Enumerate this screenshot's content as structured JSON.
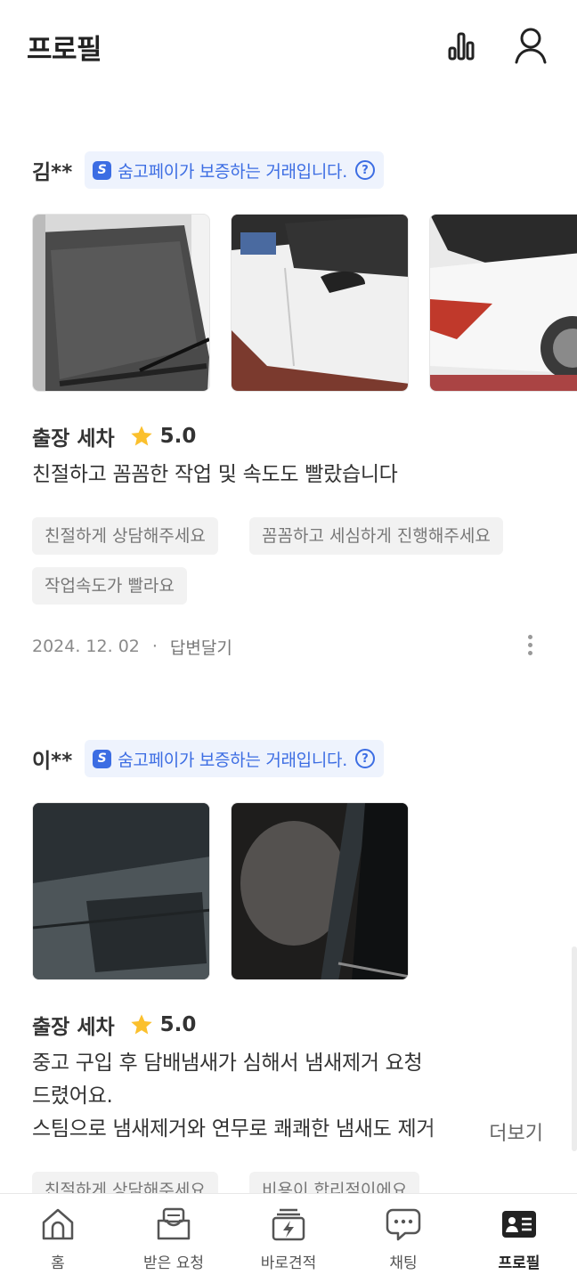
{
  "header": {
    "title": "프로필",
    "stats_icon": "bar-chart-icon",
    "user_icon": "user-icon"
  },
  "reviews": [
    {
      "reviewer": "김**",
      "badge": {
        "text": "숨고페이가 보증하는 거래입니다.",
        "logo": "S",
        "help": "?"
      },
      "photos": [
        "car-windshield-photo",
        "white-car-door-photo",
        "white-car-rear-photo"
      ],
      "service": "출장 세차",
      "rating": "5.0",
      "text_lines": [
        "친절하고 꼼꼼한 작업 및 속도도 빨랐습니다"
      ],
      "tags": [
        "친절하게 상담해주세요",
        "꼼꼼하고 세심하게 진행해주세요",
        "작업속도가 빨라요"
      ],
      "date": "2024. 12. 02",
      "dot": "·",
      "reply": "답변달기"
    },
    {
      "reviewer": "이**",
      "badge": {
        "text": "숨고페이가 보증하는 거래입니다.",
        "logo": "S",
        "help": "?"
      },
      "photos": [
        "dark-windshield-photo",
        "dark-car-interior-photo"
      ],
      "service": "출장 세차",
      "rating": "5.0",
      "text_lines": [
        "중고 구입 후 담배냄새가 심해서 냄새제거 요청",
        "드렸어요.",
        "스팀으로 냄새제거와 연무로 쾌쾌한 냄새도 제거"
      ],
      "more": "더보기",
      "tags": [
        "친절하게 상담해주세요",
        "비용이 합리적이에요"
      ]
    }
  ],
  "nav": [
    {
      "label": "홈",
      "icon": "home-icon",
      "active": false
    },
    {
      "label": "받은 요청",
      "icon": "inbox-icon",
      "active": false
    },
    {
      "label": "바로견적",
      "icon": "lightning-quote-icon",
      "active": false
    },
    {
      "label": "채팅",
      "icon": "chat-icon",
      "active": false
    },
    {
      "label": "프로필",
      "icon": "profile-card-icon",
      "active": true
    }
  ],
  "colors": {
    "accent": "#3c6de3",
    "badge_bg": "#eef3fd",
    "star": "#fbc02d",
    "tag_bg": "#f2f2f2"
  }
}
